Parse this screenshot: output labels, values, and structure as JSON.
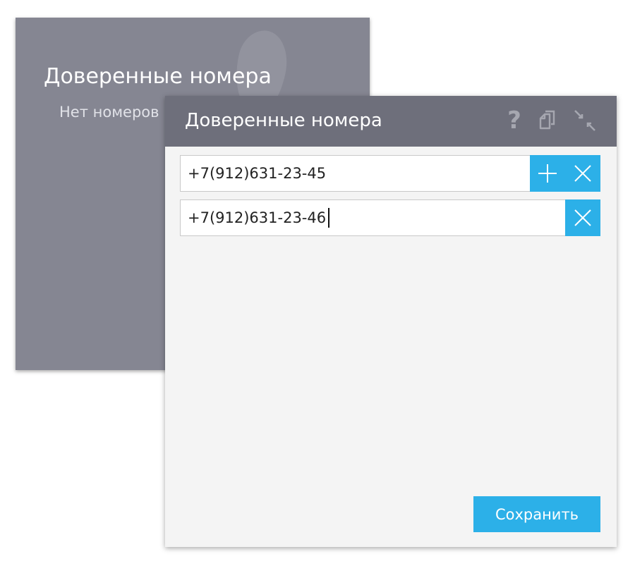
{
  "background_panel": {
    "title": "Доверенные номера",
    "subtitle": "Нет номеров"
  },
  "dialog": {
    "title": "Доверенные номера",
    "header_icons": [
      "help-icon",
      "copy-icon",
      "collapse-icon"
    ],
    "phones": [
      {
        "value": "+7(912)631-23-45",
        "actions": [
          "add",
          "remove"
        ]
      },
      {
        "value": "+7(912)631-23-46",
        "actions": [
          "remove"
        ],
        "focused": true
      }
    ],
    "save_label": "Сохранить"
  },
  "colors": {
    "accent": "#2cb0e8",
    "header_bg": "#6e6f7b",
    "background_panel": "#858692",
    "dialog_body": "#f4f4f4"
  }
}
